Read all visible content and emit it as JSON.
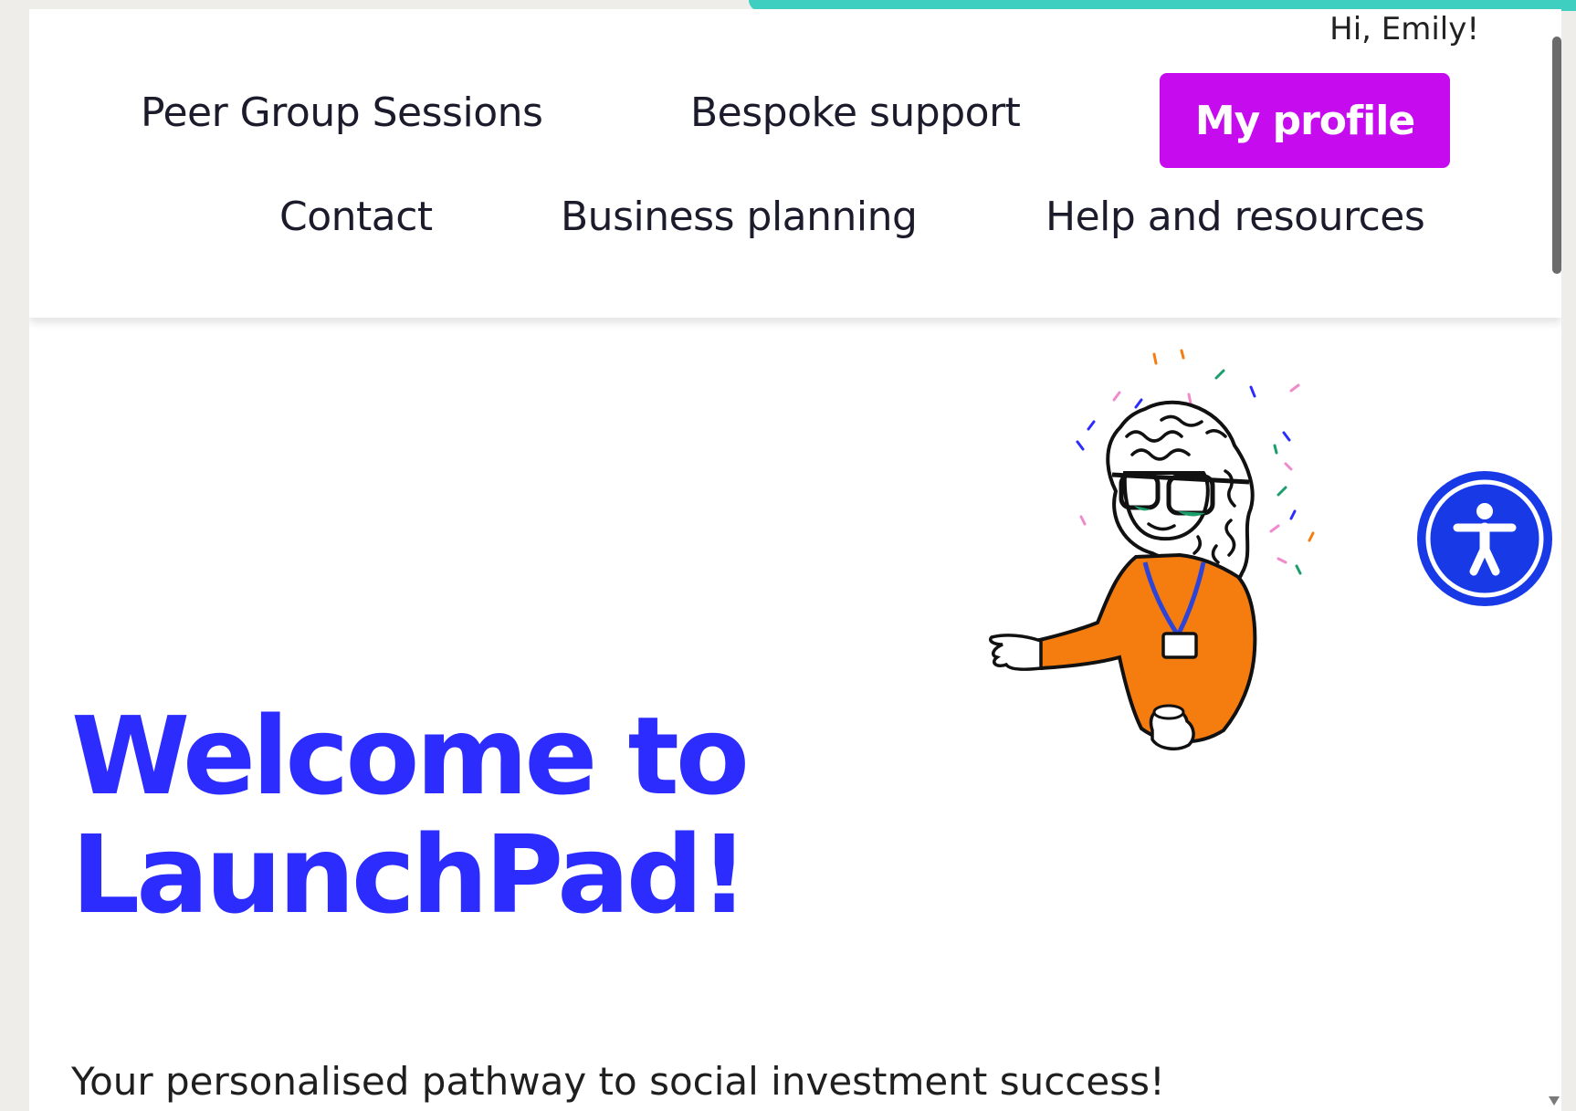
{
  "header": {
    "greeting": "Hi, Emily!",
    "nav": {
      "peer_group": "Peer Group Sessions",
      "bespoke": "Bespoke support",
      "my_profile": "My profile",
      "contact": "Contact",
      "business_planning": "Business planning",
      "help": "Help and resources"
    }
  },
  "hero": {
    "title": "Welcome to LaunchPad!",
    "subtitle": "Your personalised pathway to social investment success!"
  },
  "colors": {
    "accent_purple": "#c60bef",
    "brand_blue": "#2c2cff",
    "a11y_blue": "#1739e6",
    "teal": "#3fcfc0",
    "sweater_orange": "#f57c0f"
  },
  "icons": {
    "accessibility": "accessibility-person-icon",
    "illustration": "welcoming-person-illustration"
  }
}
